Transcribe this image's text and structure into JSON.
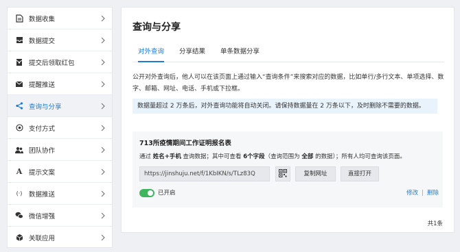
{
  "sidebar": {
    "items": [
      {
        "label": "数据收集",
        "icon": "document-icon"
      },
      {
        "label": "数据提交",
        "icon": "inbox-icon"
      },
      {
        "label": "提交后领取红包",
        "icon": "red-envelope-icon"
      },
      {
        "label": "提醒推送",
        "icon": "mail-icon"
      },
      {
        "label": "查询与分享",
        "icon": "share-icon",
        "active": true
      },
      {
        "label": "支付方式",
        "icon": "payment-icon"
      },
      {
        "label": "团队协作",
        "icon": "team-icon"
      },
      {
        "label": "提示文案",
        "icon": "text-icon"
      },
      {
        "label": "数据推送",
        "icon": "code-icon"
      },
      {
        "label": "微信增强",
        "icon": "wechat-icon"
      },
      {
        "label": "关联应用",
        "icon": "cube-icon"
      }
    ]
  },
  "main": {
    "title": "查询与分享",
    "tabs": [
      {
        "label": "对外查询",
        "active": true
      },
      {
        "label": "分享结果"
      },
      {
        "label": "单条数据分享"
      }
    ],
    "description": "公开对外查询后，他人可以在该页面上通过输入“查询条件”来搜索对应的数据，比如单行/多行文本、单项选择、数字、邮箱、网址、电话、手机或下拉框。",
    "notice": "数据量超过 2 万条后，对外查询功能将自动关闭。请保持数据量在 2 万条以下，及时删除不需要的数据。",
    "query": {
      "title": "713所疫情期间工作证明报名表",
      "line_prefix": "通过 ",
      "line_fields": "姓名+手机",
      "line_mid1": " 查询数据；其中可查看 ",
      "line_count": "6个字段",
      "line_mid2": "（查询范围为 ",
      "line_scope": "全部",
      "line_suffix": " 的数据）；所有人均可查询该页面。",
      "url": "https://jinshuju.net/f/1KbIKN/s/TLz83Q",
      "copy_label": "复制网址",
      "open_label": "直接打开",
      "toggle_label": "已开启",
      "enabled": true,
      "edit_label": "修改",
      "delete_label": "删除"
    },
    "total": "共1条"
  },
  "colors": {
    "accent": "#1f7cd2",
    "toggle_on": "#3fb55d",
    "notice_bg": "#e8f3fc"
  }
}
